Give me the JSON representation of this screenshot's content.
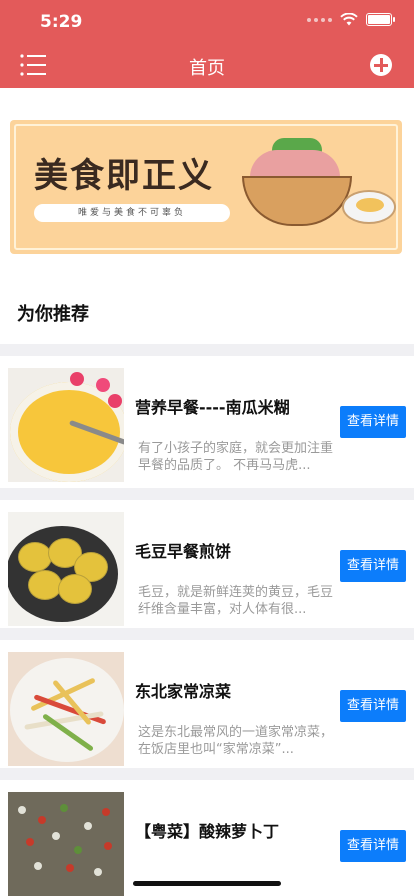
{
  "status_bar": {
    "time": "5:29"
  },
  "nav": {
    "title": "首页",
    "menu_icon": "list-menu-icon",
    "add_icon": "plus-circle-icon",
    "bar_color": "#e35a5a"
  },
  "banner": {
    "title": "美食即正义",
    "subtitle": "唯爱与美食不可辜负"
  },
  "section": {
    "title": "为你推荐"
  },
  "recipes": [
    {
      "title": "营养早餐----南瓜米糊",
      "desc": "有了小孩子的家庭，就会更加注重早餐的品质了。 不再马马虎...",
      "button": "查看详情"
    },
    {
      "title": "毛豆早餐煎饼",
      "desc": "毛豆，就是新鲜连荚的黄豆，毛豆纤维含量丰富，对人体有很...",
      "button": "查看详情"
    },
    {
      "title": "东北家常凉菜",
      "desc": "这是东北最常风的一道家常凉菜，在饭店里也叫“家常凉菜”...",
      "button": "查看详情"
    },
    {
      "title": "【粤菜】酸辣萝卜丁",
      "desc": "",
      "button": "查看详情"
    }
  ],
  "accent_colors": {
    "button": "#0c7dfb",
    "divider": "#f0f0f3"
  }
}
